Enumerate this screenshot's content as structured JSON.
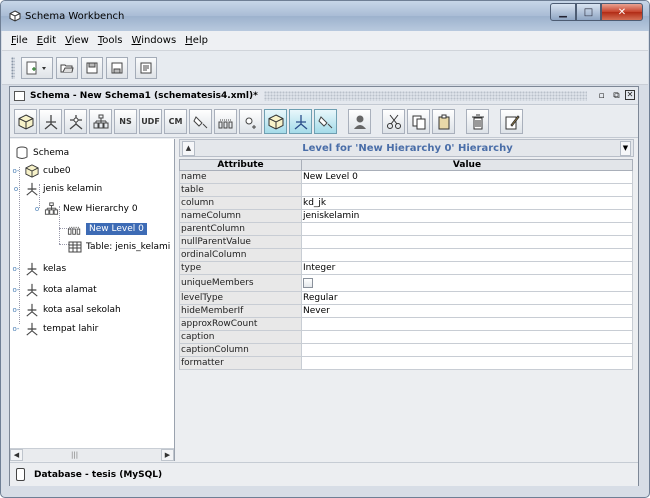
{
  "window": {
    "title": "Schema Workbench"
  },
  "menu": [
    {
      "label": "File",
      "u": "F",
      "rest": "ile"
    },
    {
      "label": "Edit",
      "u": "E",
      "rest": "dit"
    },
    {
      "label": "View",
      "u": "V",
      "rest": "iew"
    },
    {
      "label": "Tools",
      "u": "T",
      "rest": "ools"
    },
    {
      "label": "Windows",
      "u": "W",
      "rest": "indows"
    },
    {
      "label": "Help",
      "u": "H",
      "rest": "elp"
    }
  ],
  "internal_frame": {
    "title": "Schema - New Schema1 (schematesis4.xml)*"
  },
  "schema_toolbar": {
    "ns_label": "NS",
    "udf_label": "UDF",
    "cm_label": "CM"
  },
  "tree": {
    "root": "Schema",
    "cube": "cube0",
    "dim1": "jenis kelamin",
    "hierarchy": "New Hierarchy 0",
    "level": "New Level 0",
    "table": "Table: jenis_kelami",
    "dim2": "kelas",
    "dim3": "kota alamat",
    "dim4": "kota asal sekolah",
    "dim5": "tempat lahir"
  },
  "panel": {
    "heading": "Level for 'New Hierarchy 0' Hierarchy",
    "col_attribute": "Attribute",
    "col_value": "Value",
    "rows": [
      {
        "attr": "name",
        "value": "New Level 0"
      },
      {
        "attr": "table",
        "value": ""
      },
      {
        "attr": "column",
        "value": "kd_jk"
      },
      {
        "attr": "nameColumn",
        "value": "jeniskelamin"
      },
      {
        "attr": "parentColumn",
        "value": ""
      },
      {
        "attr": "nullParentValue",
        "value": ""
      },
      {
        "attr": "ordinalColumn",
        "value": ""
      },
      {
        "attr": "type",
        "value": "Integer"
      },
      {
        "attr": "uniqueMembers",
        "value": ""
      },
      {
        "attr": "levelType",
        "value": "Regular"
      },
      {
        "attr": "hideMemberIf",
        "value": "Never"
      },
      {
        "attr": "approxRowCount",
        "value": ""
      },
      {
        "attr": "caption",
        "value": ""
      },
      {
        "attr": "captionColumn",
        "value": ""
      },
      {
        "attr": "formatter",
        "value": ""
      }
    ]
  },
  "status": {
    "text": "Database - tesis (MySQL)"
  },
  "colors": {
    "selection": "#3d6bb5",
    "panel_heading": "#4a6ea8"
  }
}
